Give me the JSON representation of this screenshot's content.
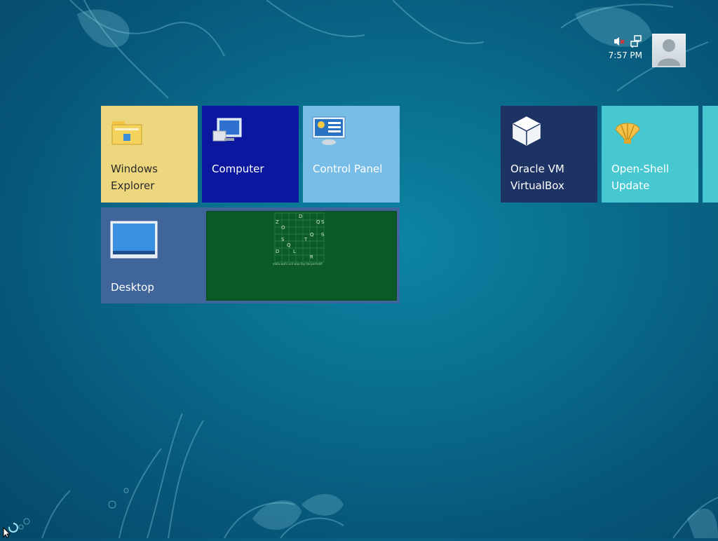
{
  "status": {
    "volume_icon": "volume-muted-icon",
    "network_icon": "network-icon",
    "time": "7:57 PM"
  },
  "user": {
    "avatar_icon": "user-avatar-icon"
  },
  "tiles": [
    {
      "label": "Windows\nExplorer",
      "icon": "folder-icon",
      "color": "#ecd77e"
    },
    {
      "label": "Computer",
      "icon": "computer-icon",
      "color": "#0a179e"
    },
    {
      "label": "Control Panel",
      "icon": "control-panel-icon",
      "color": "#77bde6"
    },
    {
      "label": "Oracle VM\nVirtualBox",
      "icon": "virtualbox-icon",
      "color": "#1d3363"
    },
    {
      "label": "Open-Shell\nUpdate",
      "icon": "shell-icon",
      "color": "#47c8d0"
    },
    {
      "label": "Desktop",
      "icon": "desktop-icon",
      "color": "#3f659b"
    }
  ],
  "desktop_preview": {
    "letters": [
      "Z",
      "D",
      "O",
      "Q",
      "S",
      "S",
      "Q",
      "T",
      "S",
      "D",
      "L",
      "R",
      "Q"
    ],
    "caption": "olatu.wuhi ucil wax.tay hacyomvelt"
  },
  "colors": {
    "background": "#0a6f8f",
    "preview_green": "#0b5a28"
  }
}
